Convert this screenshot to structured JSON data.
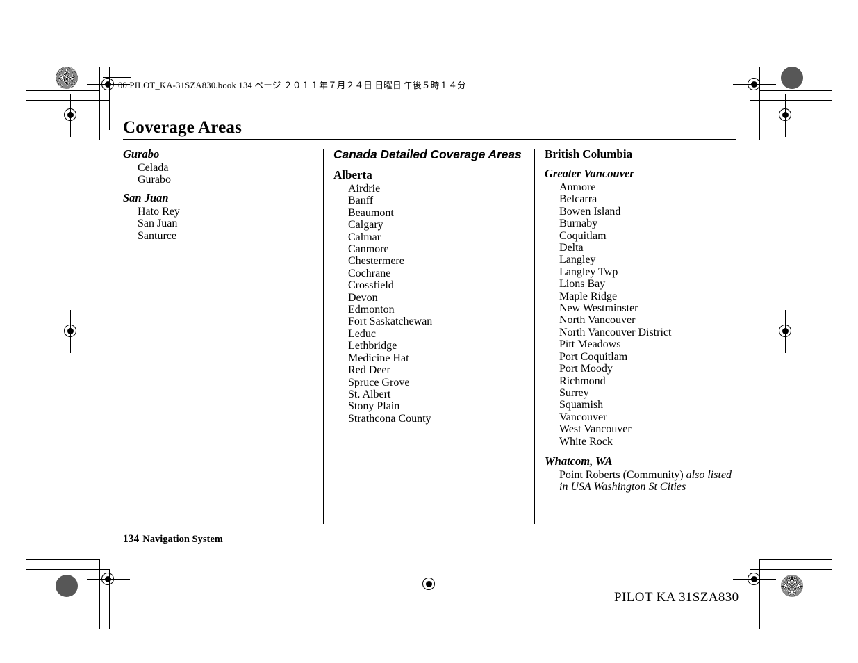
{
  "running_head": "00 PILOT_KA-31SZA830.book  134 ページ  ２０１１年７月２４日  日曜日  午後５時１４分",
  "page_title": "Coverage Areas",
  "footer": {
    "page_number": "134",
    "section": "Navigation System",
    "book_code": "PILOT KA  31SZA830"
  },
  "columns": [
    {
      "id": "column-1",
      "groups": [
        {
          "heading": "Gurabo",
          "heading_style": "bold-italic-serif",
          "items": [
            "Celada",
            "Gurabo"
          ]
        },
        {
          "heading": "San Juan",
          "heading_style": "bold-italic-serif",
          "items": [
            "Hato Rey",
            "San Juan",
            "Santurce"
          ]
        }
      ]
    },
    {
      "id": "column-2",
      "section_heading": "Canada Detailed Coverage Areas",
      "groups": [
        {
          "heading": "Alberta",
          "heading_style": "bold-serif",
          "items": [
            "Airdrie",
            "Banff",
            "Beaumont",
            "Calgary",
            "Calmar",
            "Canmore",
            "Chestermere",
            "Cochrane",
            "Crossfield",
            "Devon",
            "Edmonton",
            "Fort Saskatchewan",
            "Leduc",
            "Lethbridge",
            "Medicine Hat",
            "Red Deer",
            "Spruce Grove",
            "St. Albert",
            "Stony Plain",
            "Strathcona County"
          ]
        }
      ]
    },
    {
      "id": "column-3",
      "province_heading": "British Columbia",
      "groups": [
        {
          "heading": "Greater Vancouver",
          "heading_style": "bold-italic-serif",
          "items": [
            "Anmore",
            "Belcarra",
            "Bowen Island",
            "Burnaby",
            "Coquitlam",
            "Delta",
            "Langley",
            "Langley Twp",
            "Lions Bay",
            "Maple Ridge",
            "New Westminster",
            "North Vancouver",
            "North Vancouver District",
            "Pitt Meadows",
            "Port Coquitlam",
            "Port Moody",
            "Richmond",
            "Surrey",
            "Squamish",
            "Vancouver",
            "West Vancouver",
            "White Rock"
          ]
        },
        {
          "heading": "Whatcom, WA",
          "heading_style": "bold-italic-serif",
          "items_rich": [
            {
              "text": "Point Roberts (Community) ",
              "note": "also listed in USA Washington St Cities"
            }
          ]
        }
      ]
    }
  ]
}
